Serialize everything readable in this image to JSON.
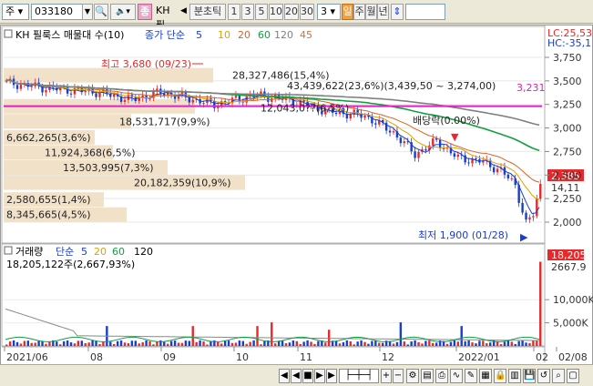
{
  "toolbar": {
    "market": "주",
    "code": "033180",
    "name": "KH 필",
    "period_label": "분초틱",
    "intervals": [
      "1",
      "3",
      "5",
      "10",
      "20",
      "30"
    ],
    "selected_count": "3",
    "day": "일",
    "week": "주",
    "month": "월",
    "year": "년"
  },
  "price_panel": {
    "title": "KH 필룩스 매물대 수(10)",
    "ma_label": "종가 단순",
    "ma_periods": [
      "5",
      "10",
      "20",
      "60",
      "120",
      "45"
    ],
    "lc": "LC:25,53",
    "hc": "HC:-35,1",
    "y_ticks": [
      "3,750",
      "3,500",
      "3,250",
      "3,000",
      "2,750",
      "2,500",
      "2,250",
      "2,000"
    ],
    "high_note": "최고 3,680 (09/23)",
    "low_note": "최저 1,900 (01/28)",
    "dividend_note": "배당락(0.00%)",
    "current_price": "2,385",
    "ref_price": "3,231",
    "sub_price": "14,11",
    "range_note": "43,439,622(23,6%)(3,439,50 ~ 3,274,00)",
    "volume_profile": [
      "28,327,486(15,4%)",
      "12,043,0??(6,5%)",
      "18,531,717(9,9%)",
      "6,662,265(3,6%)",
      "11,924,368(6,5%)",
      "13,503,995(7,3%)",
      "20,182,359(10,9%)",
      "2,580,655(1,4%)",
      "8,345,665(4,5%)"
    ]
  },
  "volume_panel": {
    "title": "거래량",
    "ma_label": "단순",
    "ma_periods": [
      "5",
      "20",
      "60",
      "120"
    ],
    "summary": "18,205,122주(2,667,93%)",
    "y_ticks": [
      "10,000K",
      "5,000K"
    ],
    "last_volume": "18,205",
    "last_pct": "2667.9"
  },
  "x_axis": [
    "2021/06",
    "08",
    "09",
    "10",
    "11",
    "12",
    "2022/01",
    "02",
    "02/08"
  ],
  "colors": {
    "up": "#e8282a",
    "down": "#1a3cd0",
    "ma5": "#1a3cd0",
    "ma10": "#e0a000",
    "ma20": "#e06020",
    "ma60": "#10a040",
    "ma120": "#808080",
    "ma45": "#e07030",
    "refline": "#e020c0",
    "profile": "#f0dcc0"
  }
}
